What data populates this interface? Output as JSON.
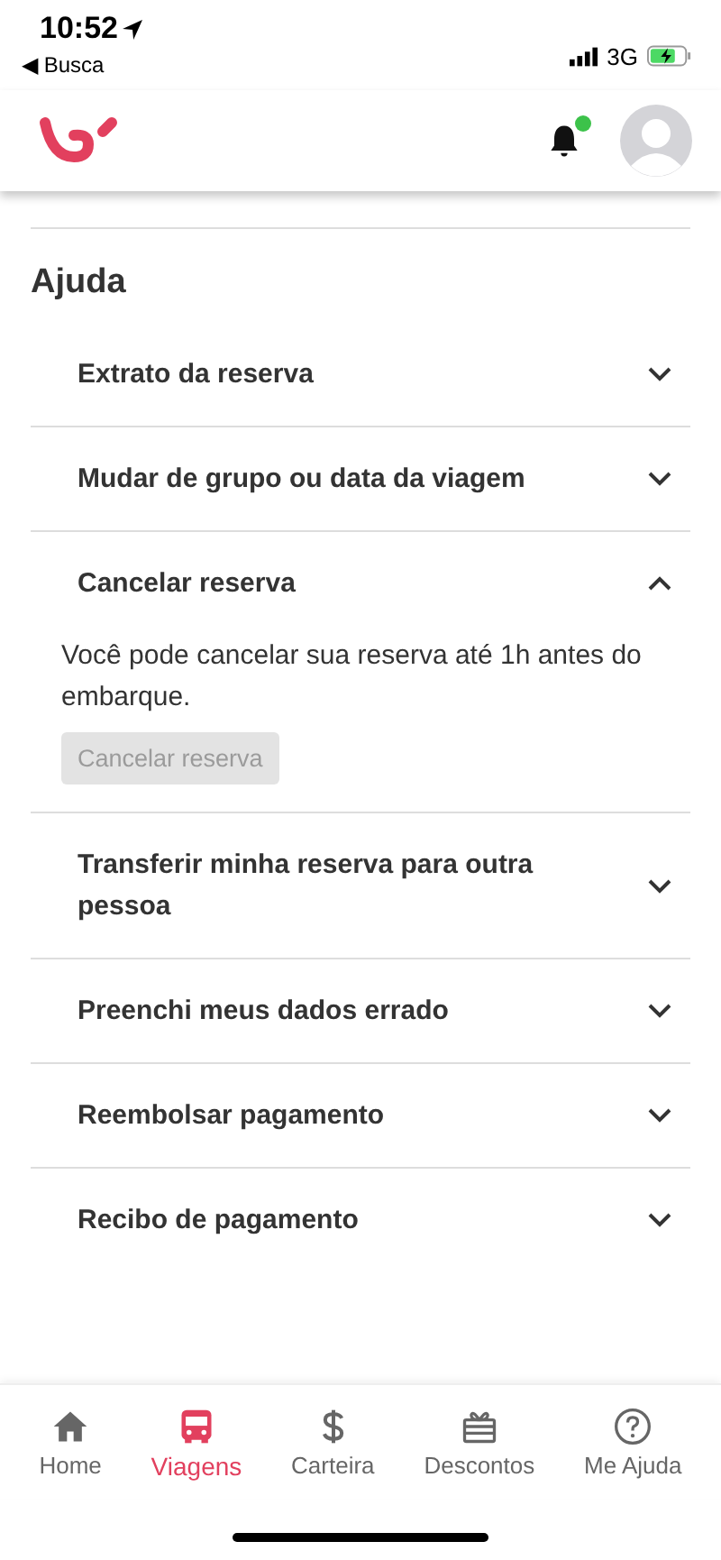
{
  "status_bar": {
    "time": "10:52",
    "back_label": "◀ Busca",
    "network": "3G"
  },
  "header": {
    "has_notification": true
  },
  "section_title": "Ajuda",
  "faq": [
    {
      "title": "Extrato da reserva",
      "expanded": false
    },
    {
      "title": "Mudar de grupo ou data da viagem",
      "expanded": false
    },
    {
      "title": "Cancelar reserva",
      "expanded": true,
      "body": "Você pode cancelar sua reserva até 1h antes do embarque.",
      "button": {
        "label": "Cancelar reserva",
        "disabled": true
      }
    },
    {
      "title": "Transferir minha reserva para outra pessoa",
      "expanded": false
    },
    {
      "title": "Preenchi meus dados errado",
      "expanded": false
    },
    {
      "title": "Reembolsar pagamento",
      "expanded": false
    },
    {
      "title": "Recibo de pagamento",
      "expanded": false
    }
  ],
  "tab_bar": [
    {
      "kind": "home",
      "label": "Home",
      "selected": false
    },
    {
      "kind": "bus",
      "label": "Viagens",
      "selected": true
    },
    {
      "kind": "dollar",
      "label": "Carteira",
      "selected": false
    },
    {
      "kind": "gift",
      "label": "Descontos",
      "selected": false
    },
    {
      "kind": "help",
      "label": "Me Ajuda",
      "selected": false
    }
  ]
}
